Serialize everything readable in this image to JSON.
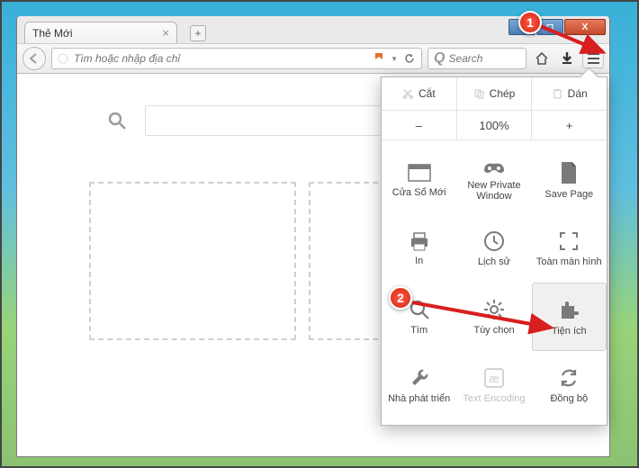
{
  "window": {
    "min": "–",
    "max": "◻",
    "close": "X"
  },
  "tab": {
    "title": "Thẻ Mới"
  },
  "urlbar": {
    "placeholder": "Tìm hoặc nhập địa chỉ"
  },
  "searchbar": {
    "magnifier": "Q",
    "placeholder": "Search"
  },
  "menu": {
    "clip": {
      "cut": "Cắt",
      "copy": "Chép",
      "paste": "Dán"
    },
    "zoom": {
      "minus": "–",
      "value": "100%",
      "plus": "+"
    },
    "items": [
      {
        "id": "new-window",
        "label": "Cửa Sổ Mới"
      },
      {
        "id": "private-window",
        "label": "New Private Window"
      },
      {
        "id": "save-page",
        "label": "Save Page"
      },
      {
        "id": "print",
        "label": "In"
      },
      {
        "id": "history",
        "label": "Lịch sử"
      },
      {
        "id": "fullscreen",
        "label": "Toàn màn hình"
      },
      {
        "id": "find",
        "label": "Tìm"
      },
      {
        "id": "options",
        "label": "Tùy chọn"
      },
      {
        "id": "addons",
        "label": "Tiện ích"
      },
      {
        "id": "developer",
        "label": "Nhà phát triển"
      },
      {
        "id": "encoding",
        "label": "Text Encoding",
        "disabled": true
      },
      {
        "id": "sync",
        "label": "Đồng bộ"
      }
    ]
  },
  "annotations": {
    "c1": "1",
    "c2": "2"
  }
}
